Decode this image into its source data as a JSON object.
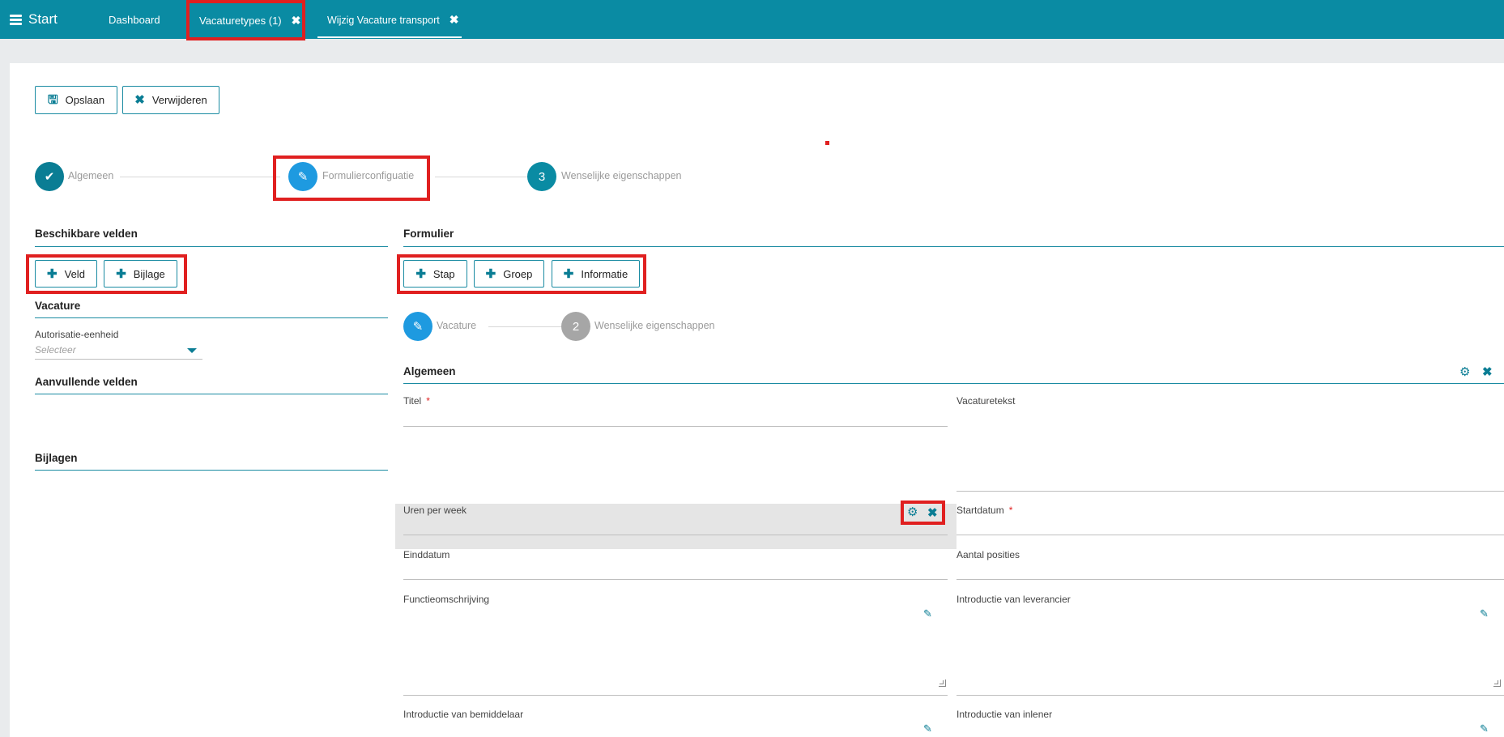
{
  "topbar": {
    "start_label": "Start",
    "tabs": [
      {
        "label": "Dashboard"
      },
      {
        "label": "Vacaturetypes (1)"
      },
      {
        "label": "Wijzig Vacature transport"
      }
    ]
  },
  "toolbar": {
    "save_label": "Opslaan",
    "delete_label": "Verwijderen"
  },
  "wizard": {
    "steps": [
      {
        "label": "Algemeen",
        "state": "done"
      },
      {
        "label": "Formulierconfiguatie",
        "state": "active"
      },
      {
        "number": "3",
        "label": "Wenselijke eigenschappen",
        "state": "todo"
      }
    ]
  },
  "left": {
    "title": "Beschikbare velden",
    "add_field_label": "Veld",
    "add_attachment_label": "Bijlage",
    "vacature_title": "Vacature",
    "auth_label": "Autorisatie-eenheid",
    "auth_placeholder": "Selecteer",
    "extra_title": "Aanvullende velden",
    "attachments_title": "Bijlagen"
  },
  "form": {
    "title": "Formulier",
    "add_step_label": "Stap",
    "add_group_label": "Groep",
    "add_info_label": "Informatie",
    "substeps": [
      {
        "label": "Vacature",
        "state": "active"
      },
      {
        "number": "2",
        "label": "Wenselijke eigenschappen",
        "state": "todo"
      }
    ],
    "group_title": "Algemeen",
    "fields": {
      "titel": "Titel",
      "vacaturetekst": "Vacaturetekst",
      "uren": "Uren per week",
      "startdatum": "Startdatum",
      "einddatum": "Einddatum",
      "aantal": "Aantal posities",
      "functie": "Functieomschrijving",
      "intro_leverancier": "Introductie van leverancier",
      "intro_bemiddelaar": "Introductie van bemiddelaar",
      "intro_inlener": "Introductie van inlener"
    },
    "required_mark": "*"
  },
  "colors": {
    "topbar": "#0a8ba3",
    "accent": "#0a7d94",
    "highlight": "#e02020"
  }
}
